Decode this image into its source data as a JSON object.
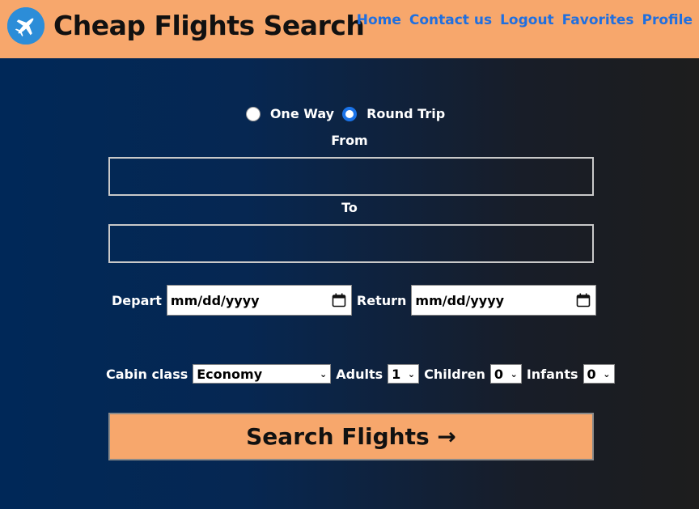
{
  "header": {
    "title": "Cheap Flights Search",
    "logo_icon": "airplane-icon",
    "nav": [
      "Home",
      "Contact us",
      "Logout",
      "Favorites",
      "Profile"
    ]
  },
  "trip_type": {
    "options": [
      "One Way",
      "Round Trip"
    ],
    "selected": "Round Trip"
  },
  "from": {
    "label": "From",
    "value": ""
  },
  "to": {
    "label": "To",
    "value": ""
  },
  "dates": {
    "depart_label": "Depart",
    "depart_value": "mm/dd/yyyy",
    "return_label": "Return",
    "return_value": "mm/dd/yyyy",
    "icon": "calendar-icon"
  },
  "passengers": {
    "cabin_label": "Cabin class",
    "cabin_value": "Economy",
    "adults_label": "Adults",
    "adults_value": "1",
    "children_label": "Children",
    "children_value": "0",
    "infants_label": "Infants",
    "infants_value": "0"
  },
  "search_button": "Search Flights →",
  "colors": {
    "header_bg": "#f7a76c",
    "nav_link": "#1f6fe0",
    "radio_accent": "#1a73e8",
    "bg_dark_blue": "#002858",
    "bg_dark": "#1d1d1d"
  }
}
